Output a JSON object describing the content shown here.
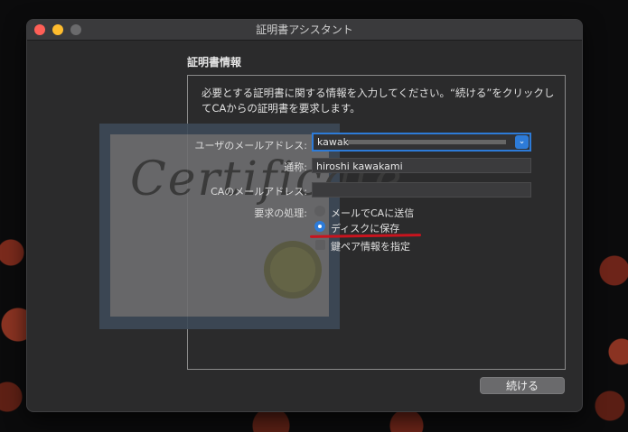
{
  "window": {
    "title": "証明書アシスタント"
  },
  "section": {
    "title": "証明書情報"
  },
  "intro_text": "必要とする証明書に関する情報を入力してください。“続ける”をクリックしてCAからの証明書を要求します。",
  "certificate_image": {
    "script_text": "Certificate"
  },
  "form": {
    "email": {
      "label": "ユーザのメールアドレス:",
      "value": "kawak"
    },
    "common_name": {
      "label": "通称:",
      "value": "hiroshi kawakami"
    },
    "ca_email": {
      "label": "CAのメールアドレス:",
      "value": ""
    },
    "request": {
      "label": "要求の処理:",
      "options": [
        {
          "label": "メールでCAに送信",
          "selected": false
        },
        {
          "label": "ディスクに保存",
          "selected": true
        }
      ]
    },
    "key_pair": {
      "label": "鍵ペア情報を指定",
      "checked": false
    }
  },
  "buttons": {
    "continue": "続ける"
  }
}
